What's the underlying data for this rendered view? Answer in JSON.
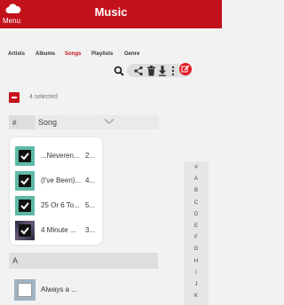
{
  "header": {
    "title": "Music",
    "menu_label": "Menu"
  },
  "tabs": [
    {
      "label": "Artists"
    },
    {
      "label": "Albums"
    },
    {
      "label": "Songs",
      "active": true
    },
    {
      "label": "Playlists"
    },
    {
      "label": "Genre"
    }
  ],
  "toolbar": {
    "icons": [
      "search-icon",
      "share-icon",
      "trash-icon",
      "download-icon",
      "more-icon",
      "edit-icon"
    ]
  },
  "selection": {
    "count_text": "4 selected"
  },
  "list_header": {
    "number_col": "#",
    "sort_label": "Song"
  },
  "selected_songs": [
    {
      "title": "...Neveren...",
      "number": "2..."
    },
    {
      "title": "(I've Been)...",
      "number": "4..."
    },
    {
      "title": "25 Or 6 To...",
      "number": "5..."
    },
    {
      "title": "4 Minute ...",
      "number": "3..."
    }
  ],
  "section": {
    "letter": "A"
  },
  "bottom_song": {
    "title": "Always a ..."
  },
  "alphabet_index": [
    "#",
    "A",
    "B",
    "C",
    "D",
    "E",
    "F",
    "G",
    "H",
    "I",
    "J",
    "K"
  ],
  "colors": {
    "brand": "#c4121c",
    "thumb_teal": "#5fb9a7"
  }
}
